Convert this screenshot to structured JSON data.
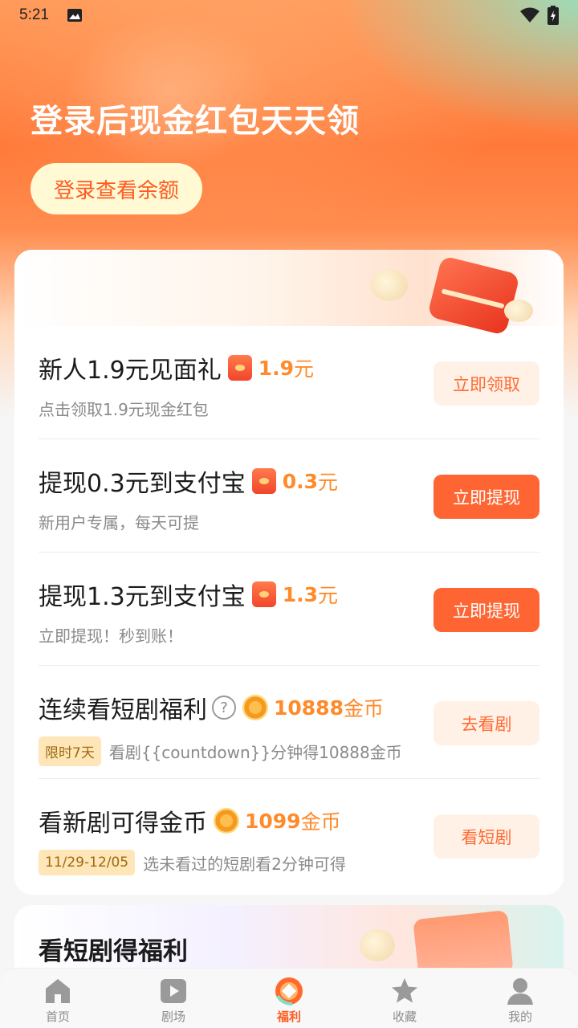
{
  "status_bar": {
    "time": "5:21",
    "icons": [
      "image-icon",
      "wifi-icon",
      "battery-icon"
    ]
  },
  "hero": {
    "title": "登录后现金红包天天领",
    "login_button": "登录查看余额"
  },
  "tasks": [
    {
      "title": "新人1.9元见面礼",
      "reward_icon": "red-packet-icon",
      "reward_value": "1.9",
      "reward_unit": "元",
      "subtitle": "点击领取1.9元现金红包",
      "tag": "",
      "button": "立即领取",
      "button_style": "light"
    },
    {
      "title": "提现0.3元到支付宝",
      "reward_icon": "red-packet-icon",
      "reward_value": "0.3",
      "reward_unit": "元",
      "subtitle": "新用户专属，每天可提",
      "tag": "",
      "button": "立即提现",
      "button_style": "solid"
    },
    {
      "title": "提现1.3元到支付宝",
      "reward_icon": "red-packet-icon",
      "reward_value": "1.3",
      "reward_unit": "元",
      "subtitle": "立即提现！秒到账！",
      "tag": "",
      "button": "立即提现",
      "button_style": "solid"
    },
    {
      "title": "连续看短剧福利",
      "reward_icon": "coin-icon",
      "reward_value": "10888",
      "reward_unit": "金币",
      "subtitle": "看剧{{countdown}}分钟得10888金币",
      "tag": "限时7天",
      "button": "去看剧",
      "button_style": "light"
    },
    {
      "title": "看新剧可得金币",
      "reward_icon": "coin-icon",
      "reward_value": "1099",
      "reward_unit": "金币",
      "subtitle": "选未看过的短剧看2分钟可得",
      "tag": "11/29-12/05",
      "button": "看短剧",
      "button_style": "light"
    }
  ],
  "section2": {
    "title": "看短剧得福利"
  },
  "tabbar": [
    {
      "label": "首页",
      "icon": "home-icon",
      "active": false
    },
    {
      "label": "剧场",
      "icon": "play-icon",
      "active": false
    },
    {
      "label": "福利",
      "icon": "welfare-icon",
      "active": true
    },
    {
      "label": "收藏",
      "icon": "star-icon",
      "active": false
    },
    {
      "label": "我的",
      "icon": "user-icon",
      "active": false
    }
  ],
  "colors": {
    "accent": "#ff6533",
    "reward": "#ff8a2a",
    "login_bg": "#fff9d4"
  }
}
